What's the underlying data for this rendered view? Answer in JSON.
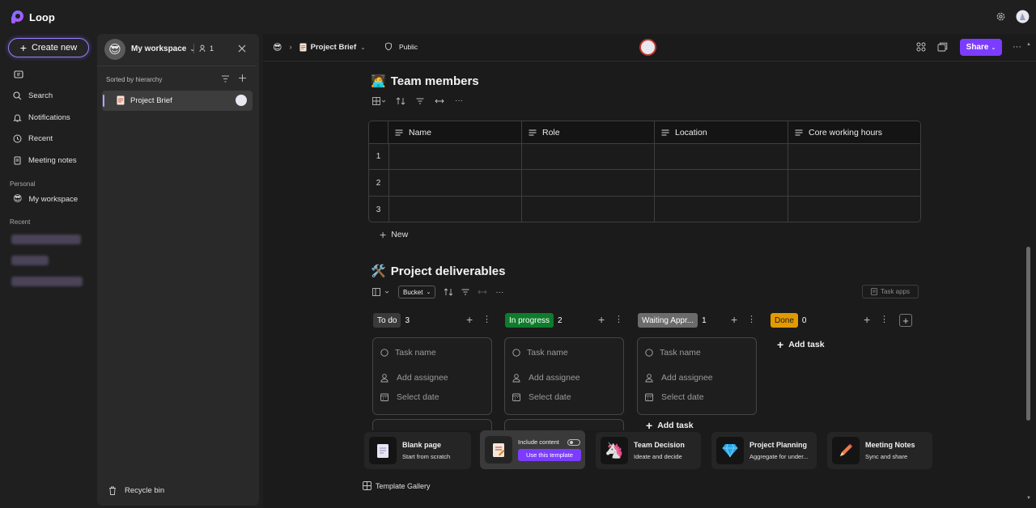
{
  "app": {
    "name": "Loop"
  },
  "nav": {
    "create_label": "Create new",
    "items": [
      "Search",
      "Notifications",
      "Recent",
      "Meeting notes"
    ],
    "personal_label": "Personal",
    "workspace_label": "My workspace",
    "recent_label": "Recent"
  },
  "workspace_panel": {
    "title": "My workspace",
    "member_count": "1",
    "sort_label": "Sorted by hierarchy",
    "page_item": "Project Brief",
    "recycle_label": "Recycle bin"
  },
  "header": {
    "breadcrumb_page": "Project Brief",
    "visibility": "Public",
    "share_label": "Share"
  },
  "team": {
    "title": "Team members",
    "columns": [
      "Name",
      "Role",
      "Location",
      "Core working hours"
    ],
    "rows": [
      "1",
      "2",
      "3"
    ],
    "new_label": "New"
  },
  "deliverables": {
    "title": "Project deliverables",
    "group_by": "Bucket",
    "task_apps_label": "Task apps",
    "buckets": [
      {
        "label": "To do",
        "count": "3",
        "color": "#3a3a3a"
      },
      {
        "label": "In progress",
        "count": "2",
        "color": "#0f7b2c"
      },
      {
        "label": "Waiting Appr...",
        "count": "1",
        "color": "#6b6b6b"
      },
      {
        "label": "Done",
        "count": "0",
        "color": "#e39a00"
      }
    ],
    "card": {
      "task_placeholder": "Task name",
      "assignee_placeholder": "Add assignee",
      "date_placeholder": "Select date"
    },
    "add_task_label": "Add task"
  },
  "templates": [
    {
      "title": "Blank page",
      "subtitle": "Start from scratch"
    },
    {
      "title": "Include content",
      "subtitle": "Use this template"
    },
    {
      "title": "Team Decision",
      "subtitle": "Ideate and decide"
    },
    {
      "title": "Project Planning",
      "subtitle": "Aggregate for under..."
    },
    {
      "title": "Meeting Notes",
      "subtitle": "Sync and share"
    }
  ],
  "template_gallery_label": "Template Gallery",
  "colors": {
    "accent": "#7c3cff",
    "create_border": "#9a7cff"
  }
}
